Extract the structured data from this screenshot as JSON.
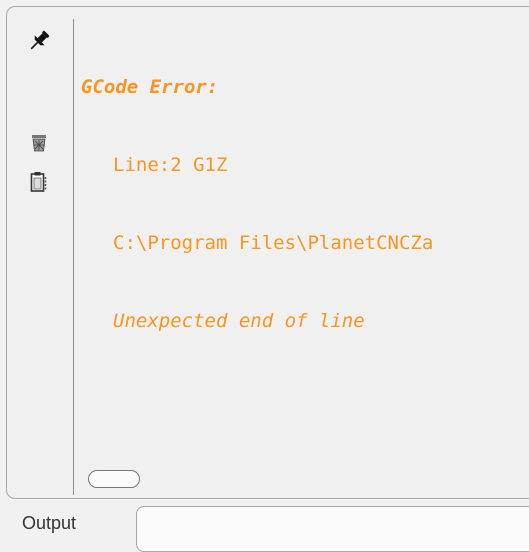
{
  "output": {
    "heading": "GCode Error:",
    "line_info": "Line:2 G1Z",
    "file_path": "C:\\Program Files\\PlanetCNCZa",
    "message": "Unexpected end of line"
  },
  "toolbar": {
    "pin_icon": "pin-icon",
    "clear_icon": "trash-icon",
    "copy_icon": "clipboard-icon"
  },
  "tab": {
    "label": "Output"
  },
  "colors": {
    "error_text": "#f7961e",
    "background": "#f0f0f0",
    "border": "#a7a7a7"
  }
}
